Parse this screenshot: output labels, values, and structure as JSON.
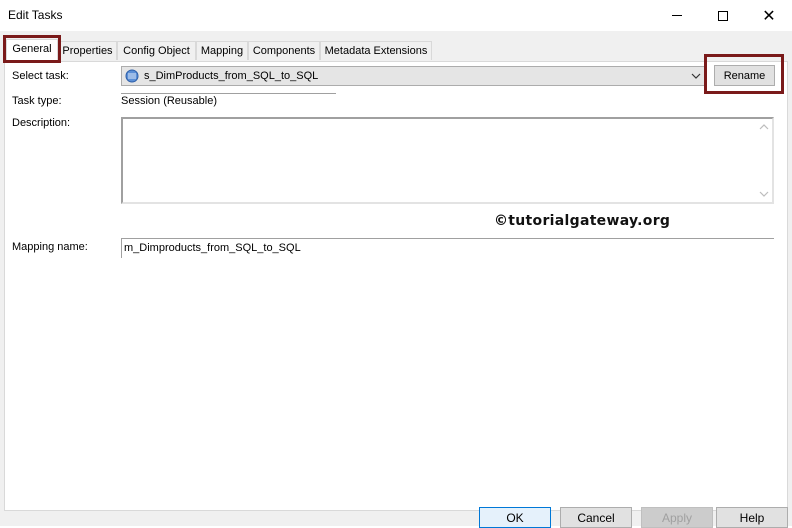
{
  "window": {
    "title": "Edit Tasks",
    "minimize_glyph": "minimize-icon",
    "maximize_glyph": "maximize-icon",
    "close_glyph": "✕"
  },
  "tabs": [
    {
      "label": "General",
      "active": true
    },
    {
      "label": "Properties",
      "active": false
    },
    {
      "label": "Config Object",
      "active": false
    },
    {
      "label": "Mapping",
      "active": false
    },
    {
      "label": "Components",
      "active": false
    },
    {
      "label": "Metadata Extensions",
      "active": false
    }
  ],
  "general": {
    "select_task_label": "Select task:",
    "select_task_value": "s_DimProducts_from_SQL_to_SQL",
    "rename_label": "Rename",
    "task_type_label": "Task type:",
    "task_type_value": "Session (Reusable)",
    "description_label": "Description:",
    "description_value": "",
    "mapping_name_label": "Mapping name:",
    "mapping_name_value": "m_Dimproducts_from_SQL_to_SQL"
  },
  "watermark": "©tutorialgateway.org",
  "footer": {
    "ok_label": "OK",
    "cancel_label": "Cancel",
    "apply_label": "Apply",
    "help_label": "Help"
  },
  "colors": {
    "highlight": "#7a1a1a",
    "panel_bg": "#ffffff",
    "dialog_bg": "#f0f0f0"
  }
}
